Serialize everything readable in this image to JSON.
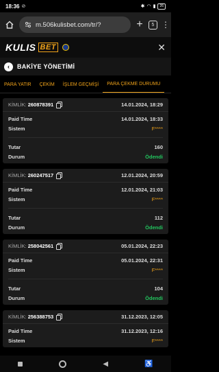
{
  "status": {
    "time": "18:36",
    "battery": "26"
  },
  "browser": {
    "url": "m.506kulisbet.com/tr/?",
    "tab_count": "5"
  },
  "site": {
    "logo_text": "KULIS",
    "logo_accent": "BET"
  },
  "page": {
    "title": "BAKİYE YÖNETİMİ"
  },
  "tabs": [
    {
      "label": "PARA YATIR"
    },
    {
      "label": "ÇEKİM"
    },
    {
      "label": "İŞLEM GEÇMİŞİ"
    },
    {
      "label": "PARA ÇEKME DURUMU"
    }
  ],
  "labels": {
    "kimlik": "KİMLİK:",
    "paid_time": "Paid Time",
    "sistem": "Sistem",
    "tutar": "Tutar",
    "durum": "Durum"
  },
  "transactions": [
    {
      "id": "260878391",
      "created": "14.01.2024, 18:29",
      "paid_time": "14.01.2024, 18:33",
      "sistem": "F****",
      "tutar": "160",
      "durum": "Ödendi"
    },
    {
      "id": "260247517",
      "created": "12.01.2024, 20:59",
      "paid_time": "12.01.2024, 21:03",
      "sistem": "F****",
      "tutar": "112",
      "durum": "Ödendi"
    },
    {
      "id": "258042561",
      "created": "05.01.2024, 22:23",
      "paid_time": "05.01.2024, 22:31",
      "sistem": "F****",
      "tutar": "104",
      "durum": "Ödendi"
    },
    {
      "id": "256388753",
      "created": "31.12.2023, 12:05",
      "paid_time": "31.12.2023, 12:16",
      "sistem": "F****",
      "tutar": "",
      "durum": ""
    }
  ],
  "colors": {
    "accent": "#f0a31a",
    "success": "#22c55e",
    "card": "#1c1c1c"
  }
}
